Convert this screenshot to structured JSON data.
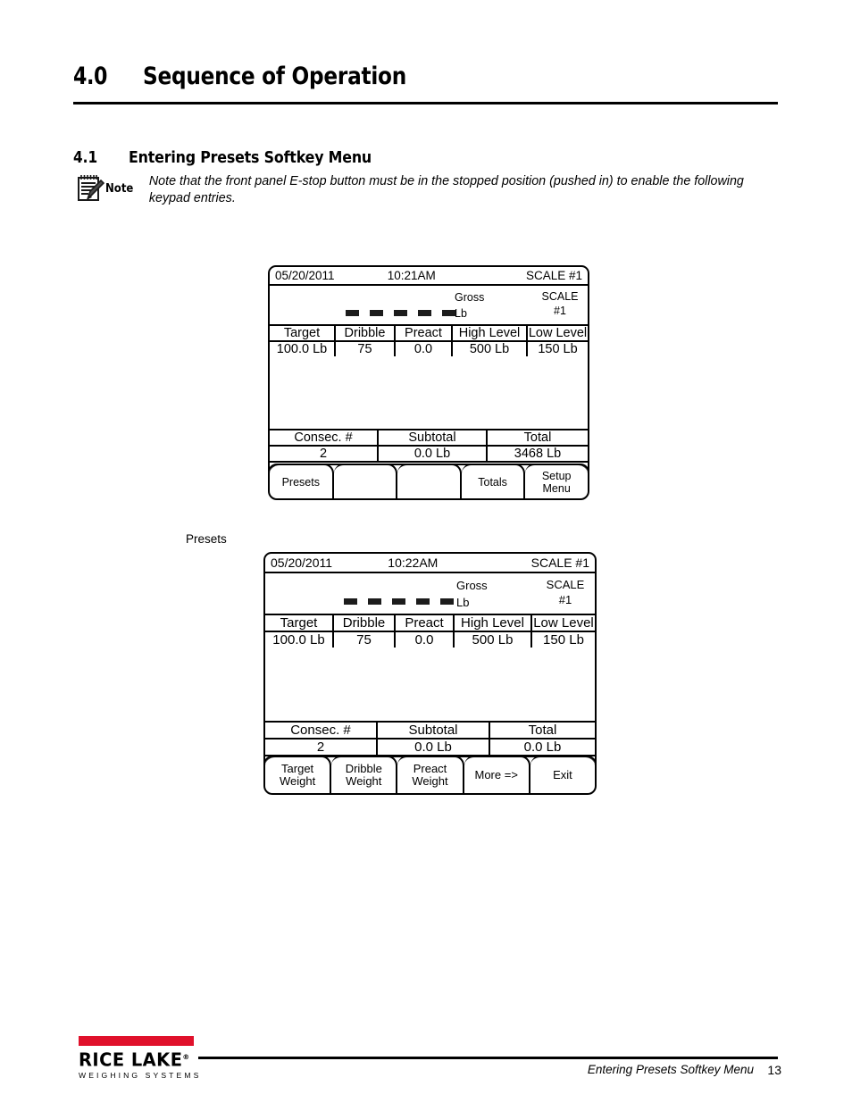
{
  "section": {
    "number": "4.0",
    "title": "Sequence of Operation"
  },
  "subsection": {
    "number": "4.1",
    "title": "Entering Presets Softkey Menu"
  },
  "note": {
    "icon": "notepad-pencil-icon",
    "label": "Note",
    "text": "Note that the front panel E-stop button must be in the stopped position (pushed in) to enable the following keypad entries."
  },
  "flow": {
    "transition_label": "Presets"
  },
  "screen1": {
    "header": {
      "date": "05/20/2011",
      "time": "10:21AM",
      "scale": "SCALE #1"
    },
    "weight": {
      "digits": "- - - - -",
      "mode": "Gross",
      "unit": "Lb",
      "scale_line1": "SCALE",
      "scale_line2": "#1"
    },
    "preset_table": {
      "headers": [
        "Target",
        "Dribble",
        "Preact",
        "High Level",
        "Low Level"
      ],
      "values": [
        "100.0 Lb",
        "75",
        "0.0",
        "500 Lb",
        "150 Lb"
      ]
    },
    "totals_table": {
      "headers": [
        "Consec. #",
        "Subtotal",
        "Total"
      ],
      "values": [
        "2",
        "0.0 Lb",
        "3468 Lb"
      ]
    },
    "softkeys": [
      "Presets",
      "",
      "",
      "Totals",
      "Setup\nMenu"
    ]
  },
  "screen2": {
    "header": {
      "date": "05/20/2011",
      "time": "10:22AM",
      "scale": "SCALE #1"
    },
    "weight": {
      "digits": "- - - - -",
      "mode": "Gross",
      "unit": "Lb",
      "scale_line1": "SCALE",
      "scale_line2": "#1"
    },
    "preset_table": {
      "headers": [
        "Target",
        "Dribble",
        "Preact",
        "High Level",
        "Low Level"
      ],
      "values": [
        "100.0 Lb",
        "75",
        "0.0",
        "500 Lb",
        "150 Lb"
      ]
    },
    "totals_table": {
      "headers": [
        "Consec. #",
        "Subtotal",
        "Total"
      ],
      "values": [
        "2",
        "0.0 Lb",
        "0.0 Lb"
      ]
    },
    "softkeys": [
      "Target\nWeight",
      "Dribble\nWeight",
      "Preact\nWeight",
      "More =>",
      "Exit"
    ]
  },
  "footer": {
    "logo_name": "RICE LAKE",
    "logo_trademark": "®",
    "logo_sub": "WEIGHING SYSTEMS",
    "logo_bar_color": "#e0112b",
    "section_ref": "Entering Presets Softkey Menu",
    "page_number": "13"
  }
}
